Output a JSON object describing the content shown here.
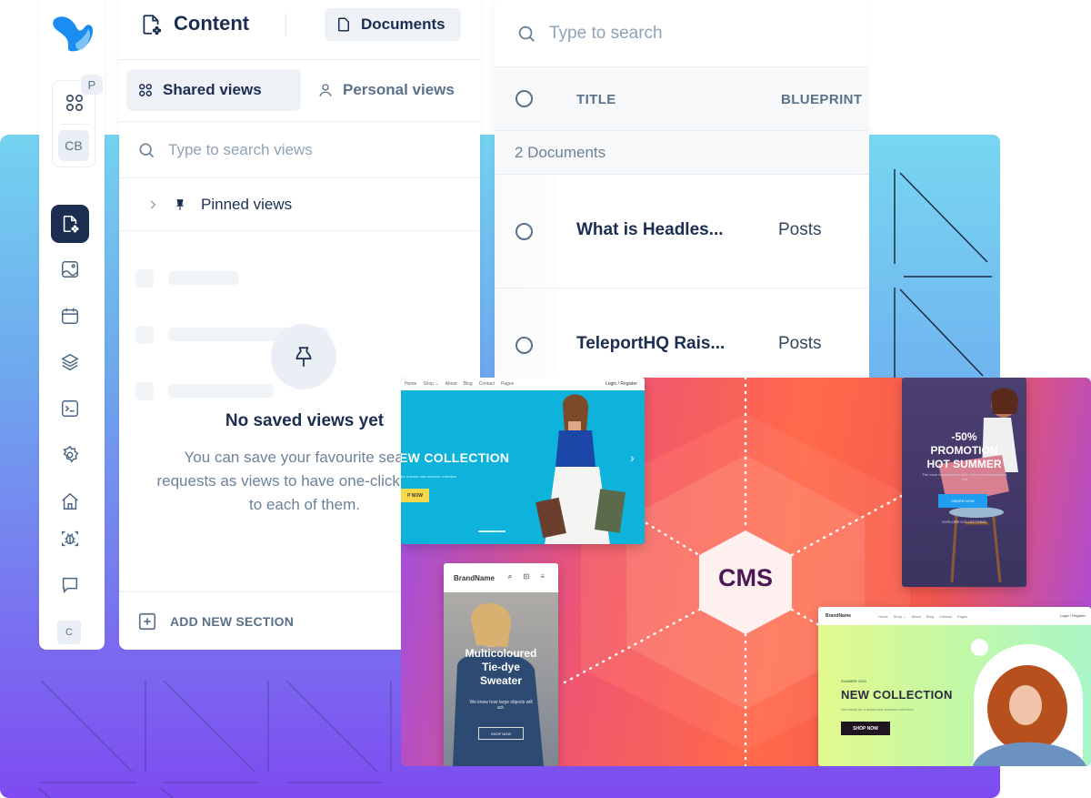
{
  "rail": {
    "workspace_badge": "P",
    "workspace_avatar": "CB",
    "items": [
      {
        "name": "content",
        "icon": "content-icon",
        "active": true
      },
      {
        "name": "media",
        "icon": "image-icon",
        "active": false
      },
      {
        "name": "releases",
        "icon": "calendar-icon",
        "active": false
      },
      {
        "name": "schema",
        "icon": "layers-icon",
        "active": false
      },
      {
        "name": "api-playground",
        "icon": "terminal-icon",
        "active": false
      },
      {
        "name": "settings",
        "icon": "gear-icon",
        "active": false
      },
      {
        "name": "home",
        "icon": "home-icon",
        "active": false
      },
      {
        "name": "debug",
        "icon": "bug-icon",
        "active": false
      },
      {
        "name": "feedback",
        "icon": "chat-icon",
        "active": false
      }
    ],
    "user_initial": "C"
  },
  "views_panel": {
    "title": "Content",
    "documents_button": "Documents",
    "tabs": [
      {
        "label": "Shared views",
        "icon": "grid-icon",
        "active": true
      },
      {
        "label": "Personal views",
        "icon": "user-icon",
        "active": false
      }
    ],
    "search_placeholder": "Type to search views",
    "pinned_label": "Pinned views",
    "empty_title": "No saved views yet",
    "empty_text": "You can save your favourite search requests as views to have one-click access to each of them.",
    "add_section_label": "ADD NEW SECTION"
  },
  "documents": {
    "search_placeholder": "Type to search",
    "columns": [
      "TITLE",
      "BLUEPRINT"
    ],
    "group_label": "2 Documents",
    "rows": [
      {
        "title": "What is Headles...",
        "blueprint": "Posts"
      },
      {
        "title": "TeleportHQ Rais...",
        "blueprint": "Posts"
      }
    ]
  },
  "illustration": {
    "center_label": "CMS",
    "card_blue": {
      "nav": [
        "Home",
        "Shop ⌄",
        "About",
        "Blog",
        "Contact",
        "Pages"
      ],
      "nav_right": "Login / Register",
      "headline": "EW COLLECTION",
      "sub": "for a brand new summer collection",
      "cta": "P NOW"
    },
    "card_promo": {
      "line1": "-50%",
      "line2": "PROMOTION",
      "line3": "HOT SUMMER",
      "sub": "The more important the work, the more important the rest",
      "cta": "ORDER NOW",
      "link": "EXPLORE COLLECTIONS"
    },
    "card_mobile": {
      "brand": "BrandName",
      "headline_1": "Multicoloured",
      "headline_2": "Tie-dye",
      "headline_3": "Sweater",
      "sub": "We know how large objects will act.",
      "cta": "SHOP NOW"
    },
    "card_green": {
      "brand": "BrandName",
      "nav": [
        "Home",
        "Shop ⌄",
        "About",
        "Blog",
        "Contact",
        "Pages"
      ],
      "nav_right": "Login / Register",
      "kicker": "SUMMER 2020",
      "headline": "NEW COLLECTION",
      "sub": "Get ready for a brand new summer collection",
      "cta": "SHOP NOW"
    }
  },
  "colors": {
    "primary_dark": "#1b2e52",
    "muted": "#5a7189",
    "bg_top": "#74d3f0",
    "bg_bottom": "#7e4bf0"
  }
}
